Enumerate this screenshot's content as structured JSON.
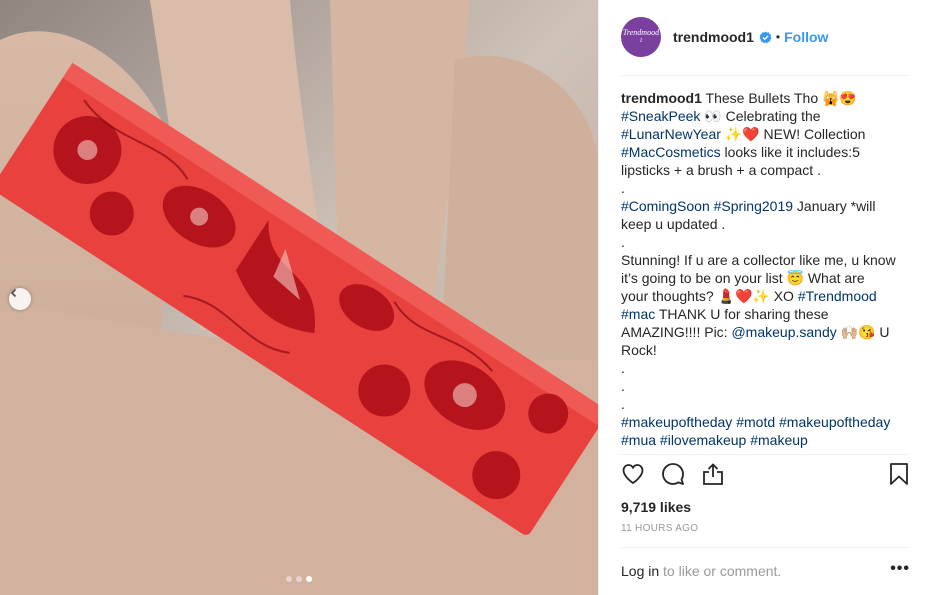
{
  "post": {
    "username": "trendmood1",
    "follow_label": "Follow",
    "separator": "•",
    "avatar_text_1": "Trendmood",
    "avatar_text_2": "1",
    "caption": {
      "lines": [
        {
          "parts": [
            {
              "t": "trendmood1",
              "k": "user"
            },
            {
              "t": " These Bullets Tho 🙀😍",
              "k": "text"
            }
          ]
        },
        {
          "parts": [
            {
              "t": "#SneakPeek",
              "k": "tag"
            },
            {
              "t": " 👀 Celebrating the",
              "k": "text"
            }
          ]
        },
        {
          "parts": [
            {
              "t": "#LunarNewYear",
              "k": "tag"
            },
            {
              "t": " ✨❤️ NEW! Collection",
              "k": "text"
            }
          ]
        },
        {
          "parts": [
            {
              "t": "#MacCosmetics",
              "k": "tag"
            },
            {
              "t": " looks like it includes:5",
              "k": "text"
            }
          ]
        },
        {
          "parts": [
            {
              "t": "lipsticks + a brush + a compact .",
              "k": "text"
            }
          ]
        },
        {
          "parts": [
            {
              "t": ".",
              "k": "text"
            }
          ]
        },
        {
          "parts": [
            {
              "t": "#ComingSoon",
              "k": "tag"
            },
            {
              "t": " ",
              "k": "text"
            },
            {
              "t": "#Spring2019",
              "k": "tag"
            },
            {
              "t": " January *will",
              "k": "text"
            }
          ]
        },
        {
          "parts": [
            {
              "t": "keep u updated .",
              "k": "text"
            }
          ]
        },
        {
          "parts": [
            {
              "t": ".",
              "k": "text"
            }
          ]
        },
        {
          "parts": [
            {
              "t": "Stunning! If u are a collector like me, u know",
              "k": "text"
            }
          ]
        },
        {
          "parts": [
            {
              "t": "it’s going to be on your list 😇 What are",
              "k": "text"
            }
          ]
        },
        {
          "parts": [
            {
              "t": "your thoughts? 💄❤️✨ XO ",
              "k": "text"
            },
            {
              "t": "#Trendmood",
              "k": "tag"
            }
          ]
        },
        {
          "parts": [
            {
              "t": "#mac",
              "k": "tag"
            },
            {
              "t": " THANK U for sharing these",
              "k": "text"
            }
          ]
        },
        {
          "parts": [
            {
              "t": "AMAZING!!!! Pic: ",
              "k": "text"
            },
            {
              "t": "@makeup.sandy",
              "k": "tag"
            },
            {
              "t": " 🙌🏼😘 U",
              "k": "text"
            }
          ]
        },
        {
          "parts": [
            {
              "t": "Rock!",
              "k": "text"
            }
          ]
        },
        {
          "parts": [
            {
              "t": ".",
              "k": "text"
            }
          ]
        },
        {
          "parts": [
            {
              "t": ".",
              "k": "text"
            }
          ]
        },
        {
          "parts": [
            {
              "t": ".",
              "k": "text"
            }
          ]
        },
        {
          "parts": [
            {
              "t": "#makeupoftheday",
              "k": "tag"
            },
            {
              "t": " ",
              "k": "text"
            },
            {
              "t": "#motd",
              "k": "tag"
            },
            {
              "t": " ",
              "k": "text"
            },
            {
              "t": "#makeupoftheday",
              "k": "tag"
            }
          ]
        },
        {
          "parts": [
            {
              "t": "#mua",
              "k": "tag"
            },
            {
              "t": " ",
              "k": "text"
            },
            {
              "t": "#ilovemakeup",
              "k": "tag"
            },
            {
              "t": " ",
              "k": "text"
            },
            {
              "t": "#makeup",
              "k": "tag"
            }
          ]
        }
      ]
    },
    "likes": "9,719 likes",
    "time_ago": "11 HOURS AGO",
    "login_link": "Log in",
    "login_rest": " to like or comment.",
    "more_label": "•••",
    "carousel": {
      "total": 3,
      "active_index": 2
    }
  },
  "icons": [
    "heart-icon",
    "comment-icon",
    "share-icon",
    "bookmark-icon",
    "verified-badge-icon",
    "chevron-left-icon"
  ],
  "colors": {
    "accent": "#3897f0",
    "hashtag": "#003569",
    "lipstick": "#e8413e",
    "foil": "#b0101a"
  }
}
